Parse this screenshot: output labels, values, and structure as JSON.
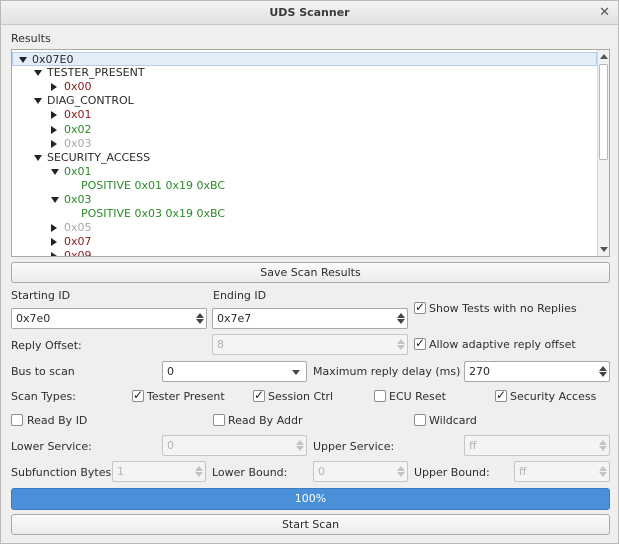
{
  "window": {
    "title": "UDS Scanner"
  },
  "results": {
    "label": "Results",
    "tree": [
      {
        "text": "0x07E0",
        "level": 0,
        "arrow": "down",
        "color": "dark",
        "selected": true
      },
      {
        "text": "TESTER_PRESENT",
        "level": 1,
        "arrow": "down",
        "color": "dark"
      },
      {
        "text": "0x00",
        "level": 2,
        "arrow": "right",
        "color": "red"
      },
      {
        "text": "DIAG_CONTROL",
        "level": 1,
        "arrow": "down",
        "color": "dark"
      },
      {
        "text": "0x01",
        "level": 2,
        "arrow": "right",
        "color": "red"
      },
      {
        "text": "0x02",
        "level": 2,
        "arrow": "right",
        "color": "green"
      },
      {
        "text": "0x03",
        "level": 2,
        "arrow": "right",
        "color": "gray"
      },
      {
        "text": "SECURITY_ACCESS",
        "level": 1,
        "arrow": "down",
        "color": "dark"
      },
      {
        "text": "0x01",
        "level": 2,
        "arrow": "down",
        "color": "green"
      },
      {
        "text": "POSITIVE  0x01 0x19 0xBC",
        "level": 3,
        "arrow": "none",
        "color": "green"
      },
      {
        "text": "0x03",
        "level": 2,
        "arrow": "down",
        "color": "green"
      },
      {
        "text": "POSITIVE  0x03 0x19 0xBC",
        "level": 3,
        "arrow": "none",
        "color": "green"
      },
      {
        "text": "0x05",
        "level": 2,
        "arrow": "right",
        "color": "gray"
      },
      {
        "text": "0x07",
        "level": 2,
        "arrow": "right",
        "color": "red"
      },
      {
        "text": "0x09",
        "level": 2,
        "arrow": "right",
        "color": "red"
      }
    ]
  },
  "save_button": "Save Scan Results",
  "starting_id": {
    "label": "Starting ID",
    "value": "0x7e0"
  },
  "ending_id": {
    "label": "Ending ID",
    "value": "0x7e7"
  },
  "show_no_replies": {
    "label": "Show Tests with no Replies",
    "checked": true
  },
  "reply_offset": {
    "label": "Reply Offset:",
    "value": "8"
  },
  "adaptive_offset": {
    "label": "Allow adaptive reply offset",
    "checked": true
  },
  "bus": {
    "label": "Bus to scan",
    "value": "0"
  },
  "max_delay": {
    "label": "Maximum reply delay (ms)",
    "value": "270"
  },
  "scan_types": {
    "label": "Scan Types:",
    "tester_present": {
      "label": "Tester Present",
      "checked": true
    },
    "session_ctrl": {
      "label": "Session Ctrl",
      "checked": true
    },
    "ecu_reset": {
      "label": "ECU Reset",
      "checked": false
    },
    "security_access": {
      "label": "Security Access",
      "checked": true
    },
    "read_by_id": {
      "label": "Read By ID",
      "checked": false
    },
    "read_by_addr": {
      "label": "Read By Addr",
      "checked": false
    },
    "wildcard": {
      "label": "Wildcard",
      "checked": false
    }
  },
  "lower_service": {
    "label": "Lower Service:",
    "value": "0"
  },
  "upper_service": {
    "label": "Upper Service:",
    "value": "ff"
  },
  "subfunction_bytes": {
    "label": "Subfunction Bytes:",
    "value": "1"
  },
  "lower_bound": {
    "label": "Lower Bound:",
    "value": "0"
  },
  "upper_bound": {
    "label": "Upper Bound:",
    "value": "ff"
  },
  "progress": {
    "value": 1.0,
    "text": "100%"
  },
  "start_button": "Start Scan"
}
